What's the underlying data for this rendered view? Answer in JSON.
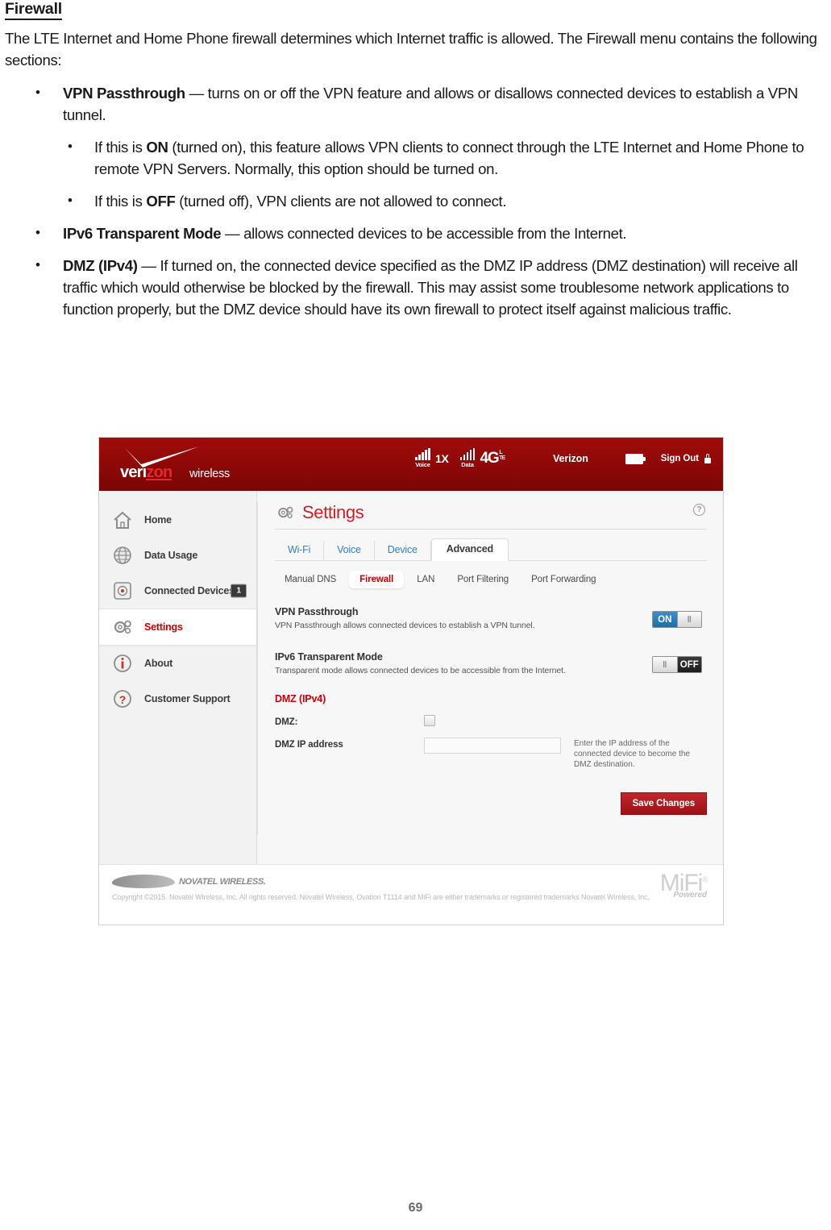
{
  "document": {
    "heading": "Firewall",
    "intro": "The LTE Internet and Home Phone firewall determines which Internet traffic is allowed. The Firewall menu contains the following sections:",
    "bullets": [
      {
        "term": "VPN Passthrough",
        "text": " — turns on or off the VPN feature and allows or disallows connected devices to establish a VPN tunnel.",
        "sub": [
          {
            "pre": "If this is ",
            "strong": "ON",
            "post": " (turned on), this feature allows VPN clients to connect through the LTE Internet and Home Phone to remote VPN Servers. Normally, this option should be turned on."
          },
          {
            "pre": "If this is ",
            "strong": "OFF",
            "post": " (turned off), VPN clients are not allowed to connect."
          }
        ]
      },
      {
        "term": "IPv6 Transparent Mode",
        "text": " — allows connected devices to be accessible from the Internet.",
        "sub": []
      },
      {
        "term": "DMZ (IPv4) ",
        "text": " — If turned on, the connected device specified as the DMZ IP address (DMZ destination) will receive all traffic which would otherwise be blocked by the firewall. This may assist some troublesome network applications to function properly, but the DMZ device should have its own firewall to protect itself against malicious traffic.",
        "sub": []
      }
    ],
    "page_number": "69"
  },
  "screenshot": {
    "header": {
      "brand_primary": "veri",
      "brand_accent": "zon",
      "brand_sub": "wireless",
      "status": {
        "voice_label": "Voice",
        "voice_network": "1X",
        "data_label": "Data",
        "data_network": "4G",
        "data_network_sup_top": "L",
        "data_network_sup_bottom": "TE",
        "carrier": "Verizon",
        "signout_label": "Sign Out"
      }
    },
    "sidebar": {
      "items": [
        {
          "label": "Home",
          "icon": "home-icon",
          "badge": null,
          "active": false
        },
        {
          "label": "Data Usage",
          "icon": "globe-icon",
          "badge": null,
          "active": false
        },
        {
          "label": "Connected Devices",
          "icon": "speaker-icon",
          "badge": "1",
          "active": false
        },
        {
          "label": "Settings",
          "icon": "gear-icon",
          "badge": null,
          "active": true
        },
        {
          "label": "About",
          "icon": "info-icon",
          "badge": null,
          "active": false
        },
        {
          "label": "Customer Support",
          "icon": "question-icon",
          "badge": null,
          "active": false
        }
      ]
    },
    "content": {
      "title": "Settings",
      "help_glyph": "?",
      "tabs": [
        {
          "label": "Wi-Fi",
          "active": false
        },
        {
          "label": "Voice",
          "active": false
        },
        {
          "label": "Device",
          "active": false
        },
        {
          "label": "Advanced",
          "active": true
        }
      ],
      "subtabs": [
        {
          "label": "Manual DNS",
          "active": false
        },
        {
          "label": "Firewall",
          "active": true
        },
        {
          "label": "LAN",
          "active": false
        },
        {
          "label": "Port Filtering",
          "active": false
        },
        {
          "label": "Port Forwarding",
          "active": false
        }
      ],
      "options": [
        {
          "title": "VPN Passthrough",
          "desc": "VPN Passthrough allows connected devices to establish a VPN tunnel.",
          "toggle_state": "ON",
          "toggle_label": "ON",
          "knob_glyph": "‖"
        },
        {
          "title": "IPv6 Transparent Mode",
          "desc": "Transparent mode allows connected devices to be accessible from the Internet.",
          "toggle_state": "OFF",
          "toggle_label": "OFF",
          "knob_glyph": "‖"
        }
      ],
      "dmz": {
        "title": "DMZ (IPv4)",
        "checkbox_label": "DMZ:",
        "checkbox_checked": false,
        "ip_label": "DMZ IP address",
        "ip_value": "",
        "ip_placeholder": "",
        "ip_hint": "Enter the IP address of the connected device to become the DMZ destination."
      },
      "save_label": "Save Changes"
    },
    "footer": {
      "brand": "NOVATEL WIRELESS.",
      "copyright": "Copyright ©2015. Novatel Wireless, Inc. All rights reserved. Novatel Wireless, Ovation T1114 and MiFi are either trademarks or registered trademarks Novatel Wireless, Inc.",
      "mifi_word": "MiFi",
      "mifi_sup": "®",
      "mifi_powered": "Powered"
    }
  },
  "colors": {
    "verizon_red": "#8d0808",
    "accent_red": "#cc0000",
    "link_blue": "#2f7fd4",
    "toggle_on_blue": "#1f6ea8",
    "toggle_off_dark": "#2a2a2a"
  }
}
